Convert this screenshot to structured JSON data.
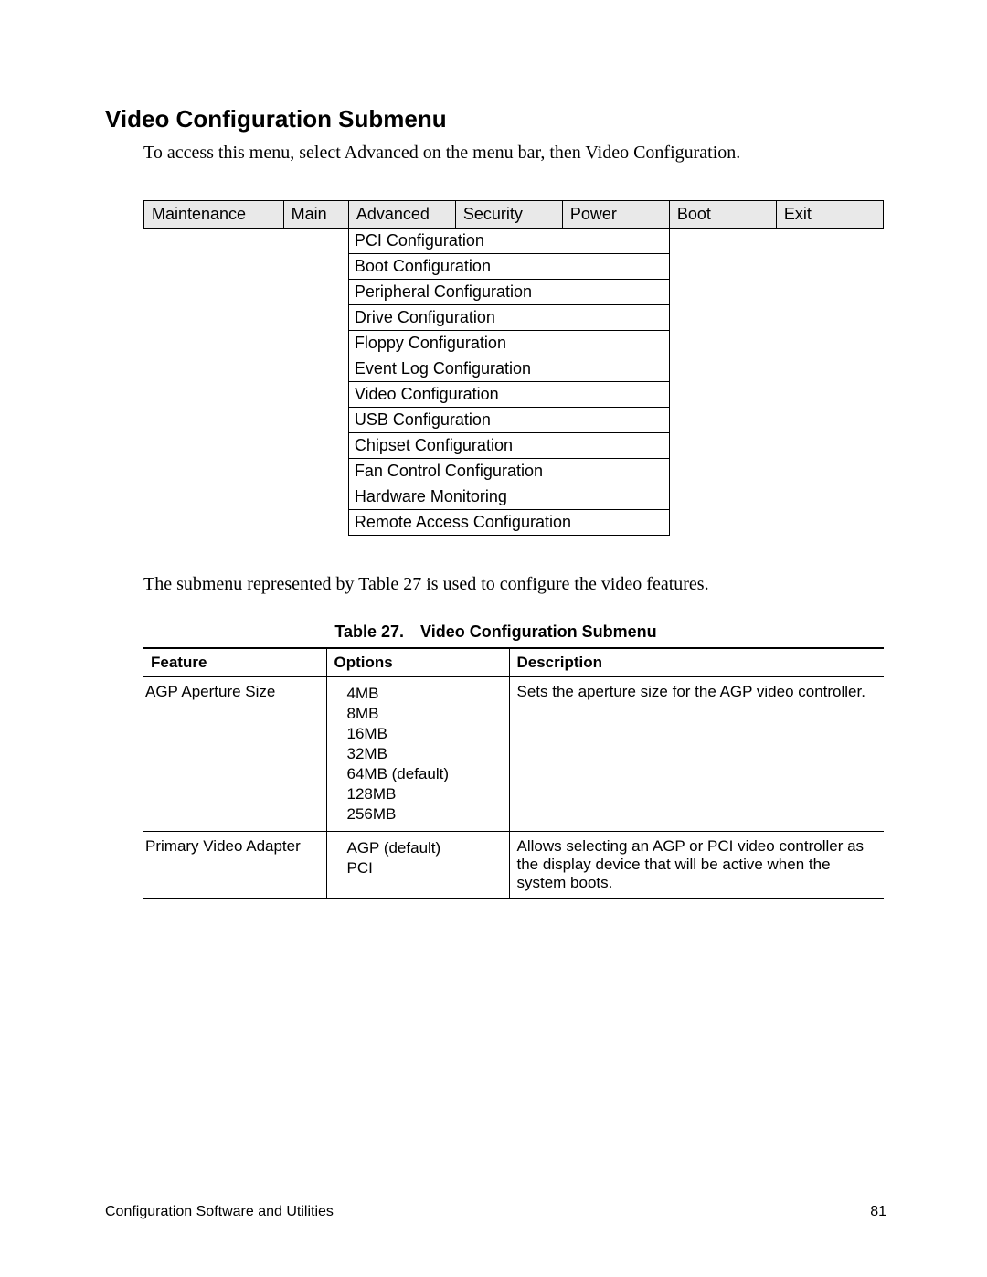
{
  "title": "Video Configuration Submenu",
  "intro": "To access this menu, select Advanced on the menu bar, then Video Configuration.",
  "menubar": [
    "Maintenance",
    "Main",
    "Advanced",
    "Security",
    "Power",
    "Boot",
    "Exit"
  ],
  "submenu_items": [
    "PCI Configuration",
    "Boot Configuration",
    "Peripheral Configuration",
    "Drive Configuration",
    "Floppy Configuration",
    "Event Log Configuration",
    " Video Configuration",
    "USB Configuration",
    "Chipset Configuration",
    "Fan Control Configuration",
    "Hardware Monitoring",
    "Remote Access Configuration"
  ],
  "afterpara": "The submenu represented by Table 27 is used to configure the video features.",
  "table_caption": "Table 27. Video Configuration Submenu",
  "table_headers": {
    "feature": "Feature",
    "options": "Options",
    "description": "Description"
  },
  "rows": [
    {
      "feature": "AGP Aperture Size",
      "options": [
        "4MB",
        "8MB",
        "16MB",
        "32MB",
        "64MB (default)",
        "128MB",
        "256MB"
      ],
      "description": "Sets the aperture size for the AGP video controller."
    },
    {
      "feature": "Primary Video Adapter",
      "options": [
        "AGP (default)",
        "PCI"
      ],
      "description": "Allows selecting an AGP or PCI video controller as the display device that will be active when the system boots."
    }
  ],
  "footer": {
    "left": "Configuration Software and Utilities",
    "right": "81"
  }
}
